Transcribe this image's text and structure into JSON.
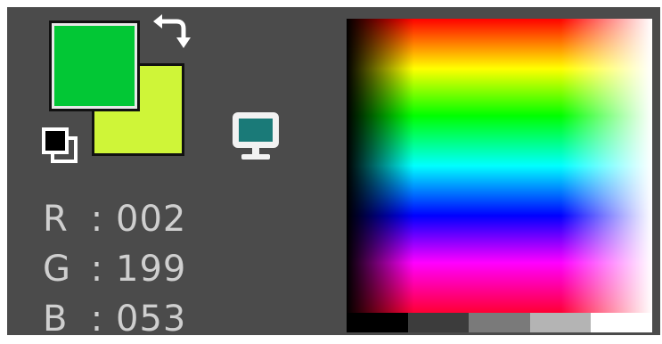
{
  "colors": {
    "foreground": "#02C735",
    "background": "#CFF538",
    "panel": "#4B4B4B",
    "text": "#CFCFCF"
  },
  "icons": {
    "swap": "swap-colors-icon",
    "reset": "default-colors-icon",
    "screen": "screen-color-picker-icon"
  },
  "readout": {
    "r_label": "R",
    "r_sep": ":",
    "r_value": "002",
    "g_label": "G",
    "g_sep": ":",
    "g_value": "199",
    "b_label": "B",
    "b_sep": ":",
    "b_value": "053"
  },
  "gray_strip": [
    "#000000",
    "#3c3c3c",
    "#7a7a7a",
    "#b4b4b4",
    "#ffffff"
  ]
}
